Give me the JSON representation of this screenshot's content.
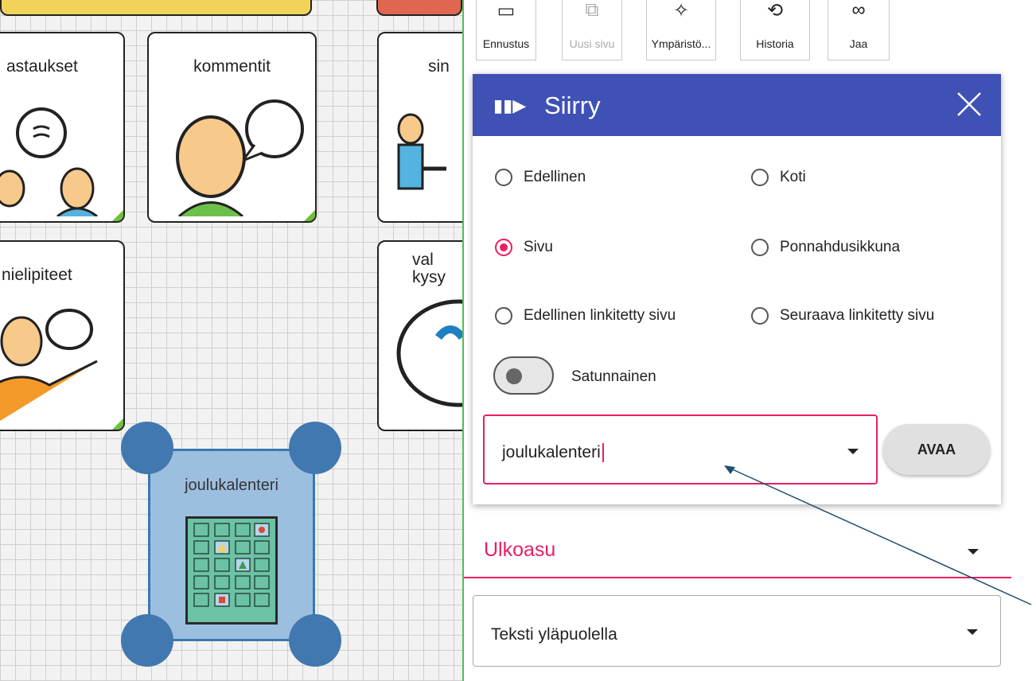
{
  "board": {
    "tiles": [
      {
        "label": "astaukset"
      },
      {
        "label": "kommentit"
      },
      {
        "label": "sin"
      },
      {
        "label": "nielipiteet"
      },
      {
        "label": "val kysy"
      }
    ],
    "selected_tile": {
      "label": "joulukalenteri"
    }
  },
  "toolbar": {
    "buttons": [
      {
        "label": "Ennustus",
        "icon": "prediction-icon"
      },
      {
        "label": "Uusi sivu",
        "icon": "new-page-icon",
        "disabled": true
      },
      {
        "label": "Ympäristö...",
        "icon": "lightbulb-icon"
      },
      {
        "label": "Historia",
        "icon": "history-icon"
      },
      {
        "label": "Jaa",
        "icon": "share-icon"
      }
    ]
  },
  "dialog": {
    "title": "Siirry",
    "options": [
      {
        "label": "Edellinen",
        "selected": false
      },
      {
        "label": "Koti",
        "selected": false
      },
      {
        "label": "Sivu",
        "selected": true
      },
      {
        "label": "Ponnahdusikkuna",
        "selected": false
      },
      {
        "label": "Edellinen linkitetty sivu",
        "selected": false
      },
      {
        "label": "Seuraava linkitetty sivu",
        "selected": false
      }
    ],
    "toggle": {
      "label": "Satunnainen",
      "on": false
    },
    "page_field": {
      "value": "joulukalenteri"
    },
    "open_button": "AVAA"
  },
  "appearance": {
    "section_title": "Ulkoasu",
    "text_position": "Teksti yläpuolella"
  },
  "colors": {
    "dialog_header": "#3f51b5",
    "accent": "#e91e63",
    "selection": "#4178b0"
  }
}
